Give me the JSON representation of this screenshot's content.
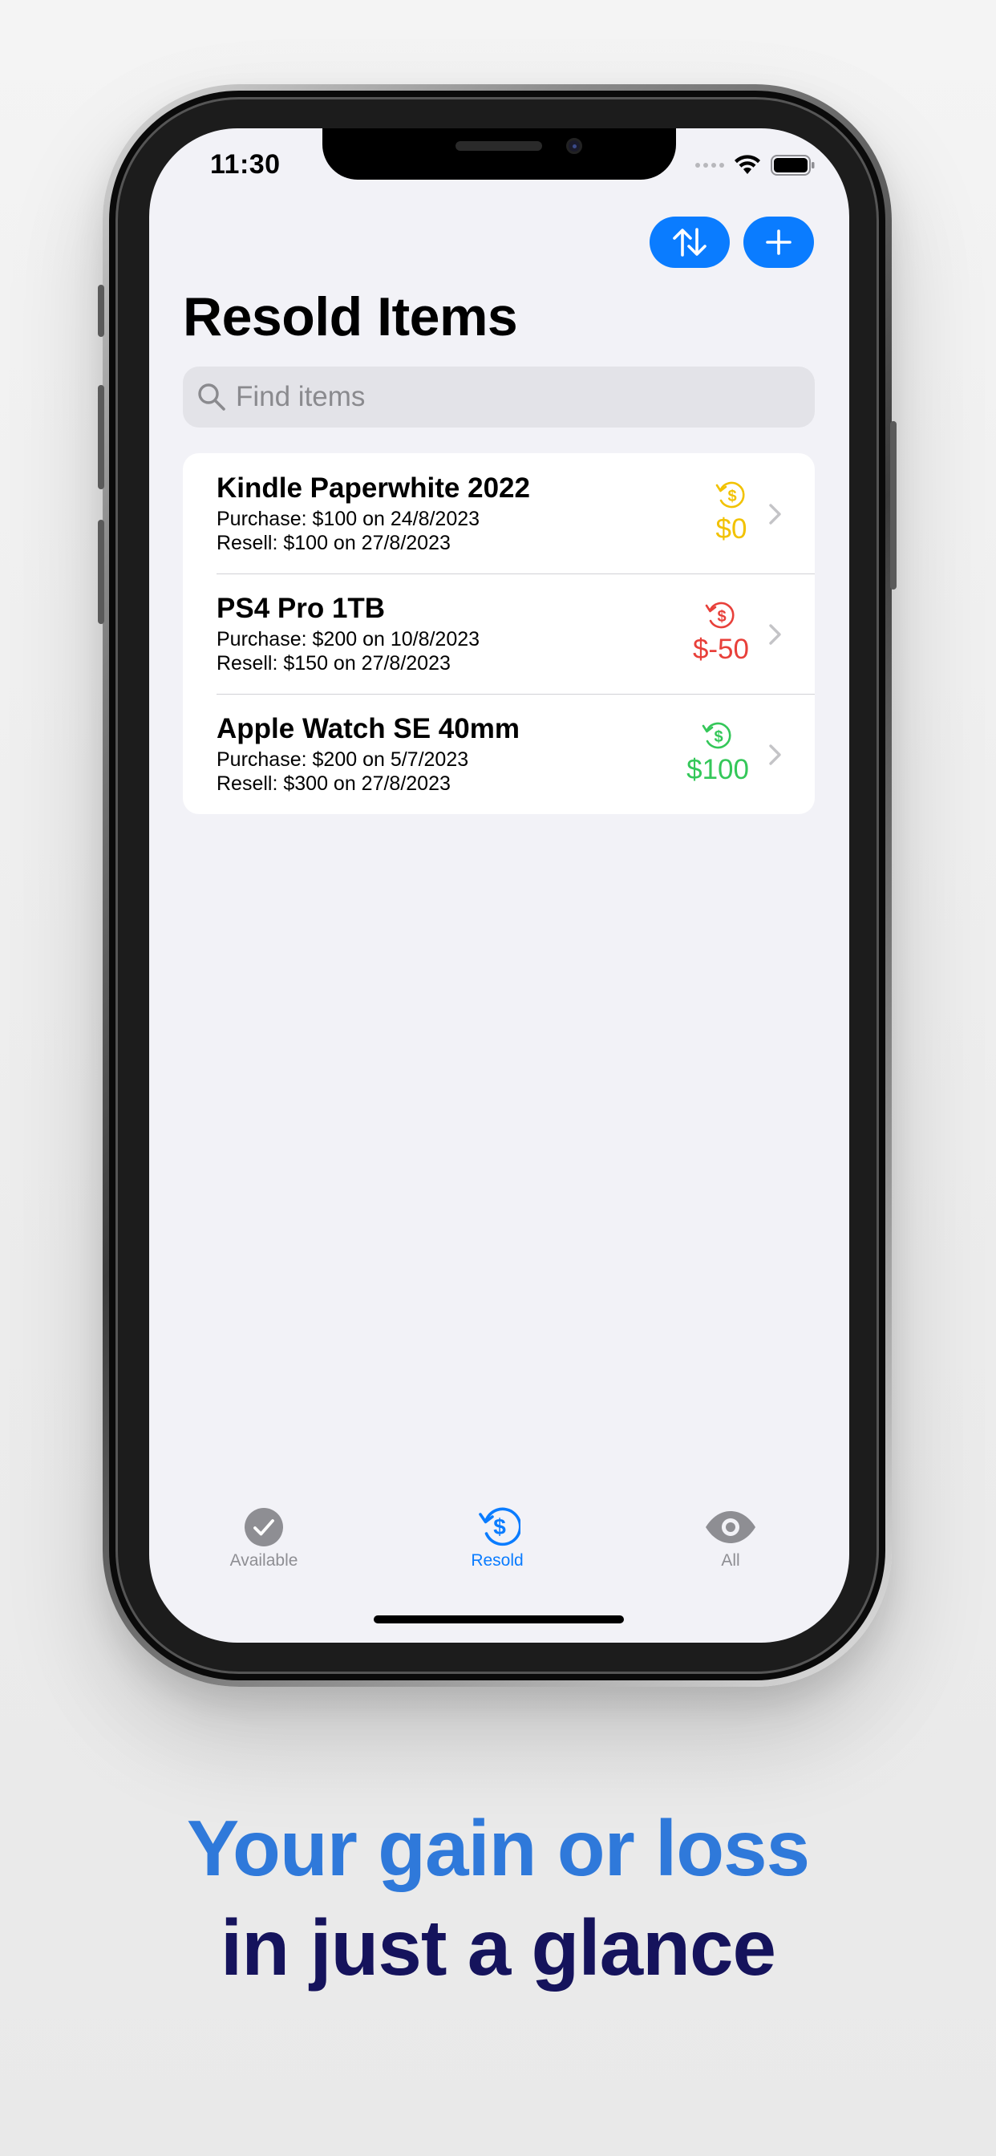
{
  "status_bar": {
    "time": "11:30"
  },
  "toolbar": {
    "sort_icon": "sort-arrows-icon",
    "add_icon": "plus-icon",
    "accent_color": "#0a7cff"
  },
  "page": {
    "title": "Resold Items"
  },
  "search": {
    "placeholder": "Find items",
    "value": ""
  },
  "items": [
    {
      "name": "Kindle Paperwhite 2022",
      "purchase": "Purchase: $100 on 24/8/2023",
      "resell": "Resell: $100 on 27/8/2023",
      "profit": "$0",
      "profit_color": "#f2c200"
    },
    {
      "name": "PS4 Pro 1TB",
      "purchase": "Purchase: $200 on 10/8/2023",
      "resell": "Resell: $150 on 27/8/2023",
      "profit": "$-50",
      "profit_color": "#e8403a"
    },
    {
      "name": "Apple Watch SE 40mm",
      "purchase": "Purchase: $200 on 5/7/2023",
      "resell": "Resell: $300 on 27/8/2023",
      "profit": "$100",
      "profit_color": "#34c759"
    }
  ],
  "tabs": [
    {
      "label": "Available",
      "icon": "checkmark-circle-icon",
      "active": false
    },
    {
      "label": "Resold",
      "icon": "dollar-cycle-icon",
      "active": true
    },
    {
      "label": "All",
      "icon": "eye-icon",
      "active": false
    }
  ],
  "tab_colors": {
    "active": "#0a7cff",
    "inactive": "#8e8e93"
  },
  "tagline": {
    "line1": "Your gain or loss",
    "line2": "in just a glance"
  }
}
